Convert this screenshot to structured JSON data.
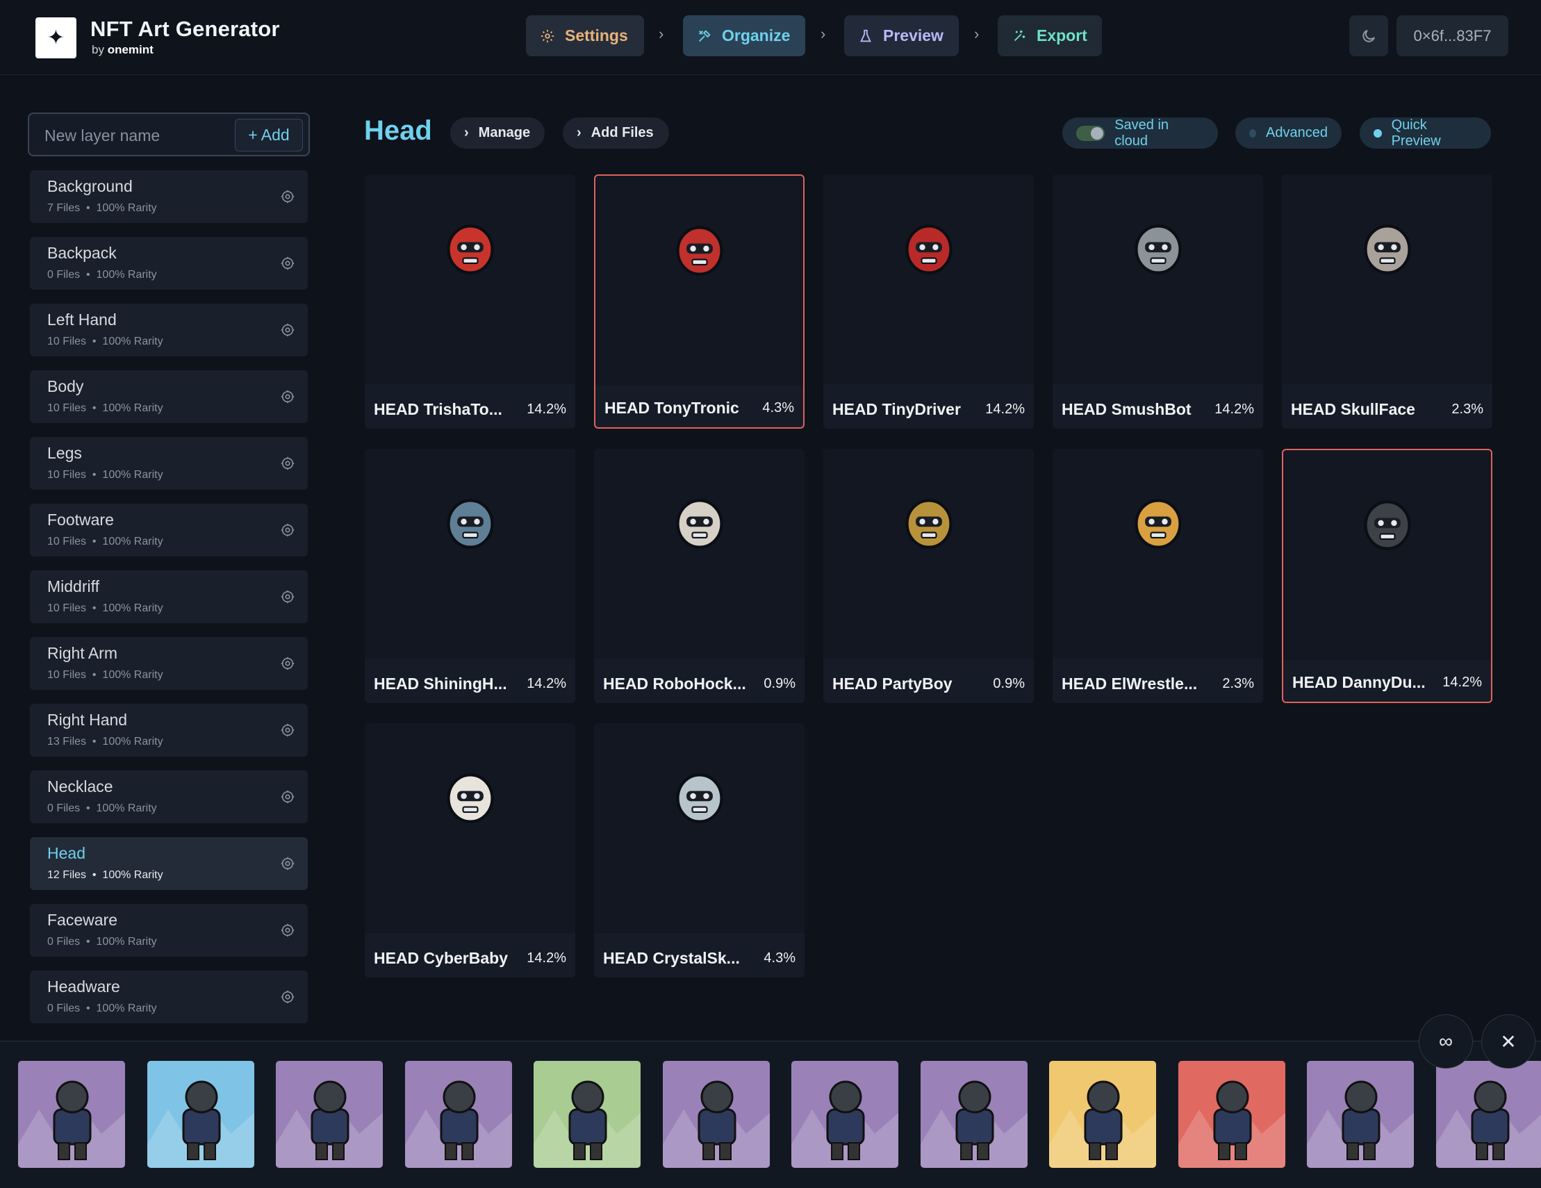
{
  "header": {
    "title": "NFT Art Generator",
    "subtitle_prefix": "by",
    "subtitle_brand": "onemint",
    "steps": [
      {
        "label": "Settings"
      },
      {
        "label": "Organize"
      },
      {
        "label": "Preview"
      },
      {
        "label": "Export"
      }
    ],
    "wallet": "0×6f...83F7"
  },
  "sidebar": {
    "new_layer_placeholder": "New layer name",
    "add_label": "+ Add",
    "layers": [
      {
        "name": "Background",
        "files": "7 Files",
        "rarity": "100% Rarity"
      },
      {
        "name": "Backpack",
        "files": "0 Files",
        "rarity": "100% Rarity"
      },
      {
        "name": "Left Hand",
        "files": "10 Files",
        "rarity": "100% Rarity"
      },
      {
        "name": "Body",
        "files": "10 Files",
        "rarity": "100% Rarity"
      },
      {
        "name": "Legs",
        "files": "10 Files",
        "rarity": "100% Rarity"
      },
      {
        "name": "Footware",
        "files": "10 Files",
        "rarity": "100% Rarity"
      },
      {
        "name": "Middriff",
        "files": "10 Files",
        "rarity": "100% Rarity"
      },
      {
        "name": "Right Arm",
        "files": "10 Files",
        "rarity": "100% Rarity"
      },
      {
        "name": "Right Hand",
        "files": "13 Files",
        "rarity": "100% Rarity"
      },
      {
        "name": "Necklace",
        "files": "0 Files",
        "rarity": "100% Rarity"
      },
      {
        "name": "Head",
        "files": "12 Files",
        "rarity": "100% Rarity"
      },
      {
        "name": "Faceware",
        "files": "0 Files",
        "rarity": "100% Rarity"
      },
      {
        "name": "Headware",
        "files": "0 Files",
        "rarity": "100% Rarity"
      }
    ]
  },
  "main": {
    "title": "Head",
    "manage_label": "Manage",
    "add_files_label": "Add Files",
    "saved_label": "Saved in cloud",
    "advanced_label": "Advanced",
    "quick_preview_label": "Quick Preview",
    "items": [
      {
        "name": "HEAD TrishaTo...",
        "pct": "14.2%",
        "color": "#c8342c"
      },
      {
        "name": "HEAD TonyTronic",
        "pct": "4.3%",
        "color": "#c0302c"
      },
      {
        "name": "HEAD TinyDriver",
        "pct": "14.2%",
        "color": "#b82a28"
      },
      {
        "name": "HEAD SmushBot",
        "pct": "14.2%",
        "color": "#8b9298"
      },
      {
        "name": "HEAD SkullFace",
        "pct": "2.3%",
        "color": "#a8a29a"
      },
      {
        "name": "HEAD ShiningH...",
        "pct": "14.2%",
        "color": "#5f7f96"
      },
      {
        "name": "HEAD RoboHock...",
        "pct": "0.9%",
        "color": "#d6d0c6"
      },
      {
        "name": "HEAD PartyBoy",
        "pct": "0.9%",
        "color": "#b8923a"
      },
      {
        "name": "HEAD ElWrestle...",
        "pct": "2.3%",
        "color": "#d8a040"
      },
      {
        "name": "HEAD DannyDu...",
        "pct": "14.2%",
        "color": "#3e4246"
      },
      {
        "name": "HEAD CyberBaby",
        "pct": "14.2%",
        "color": "#e8e4dc"
      },
      {
        "name": "HEAD CrystalSk...",
        "pct": "4.3%",
        "color": "#b8c4cc"
      }
    ]
  },
  "preview_strip": {
    "thumb_backgrounds": [
      "#9a82b8",
      "#7fc4e6",
      "#9a82b8",
      "#9a82b8",
      "#a8cc92",
      "#9a82b8",
      "#9a82b8",
      "#9a82b8",
      "#f0c870",
      "#e06a62",
      "#9a82b8",
      "#9a82b8"
    ]
  }
}
